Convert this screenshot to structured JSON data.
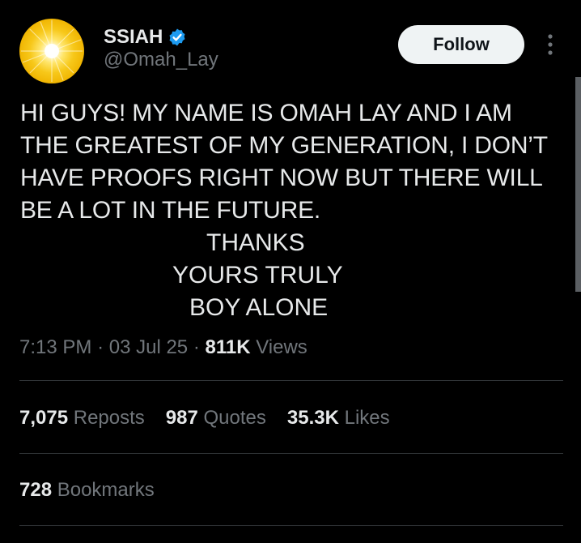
{
  "author": {
    "display_name": "SSIAH",
    "handle": "@Omah_Lay",
    "verified": true,
    "avatar_icon": "sun-avatar",
    "verified_icon": "verified-badge-icon",
    "verified_color": "#1d9bf0"
  },
  "actions": {
    "follow_label": "Follow",
    "more_icon": "more-vertical-icon"
  },
  "tweet": {
    "lines": [
      "HI GUYS! MY NAME IS OMAH LAY AND I AM",
      "THE GREATEST OF MY GENERATION, I DON’T",
      "HAVE PROOFS RIGHT NOW BUT THERE WILL",
      "BE A LOT IN THE FUTURE."
    ],
    "signoff": [
      "THANKS",
      "YOURS TRULY",
      "BOY ALONE"
    ]
  },
  "meta": {
    "time": "7:13 PM",
    "separator": "·",
    "date": "03 Jul 25",
    "views_count": "811K",
    "views_label": "Views"
  },
  "stats": {
    "reposts_count": "7,075",
    "reposts_label": "Reposts",
    "quotes_count": "987",
    "quotes_label": "Quotes",
    "likes_count": "35.3K",
    "likes_label": "Likes",
    "bookmarks_count": "728",
    "bookmarks_label": "Bookmarks"
  },
  "colors": {
    "background": "#000000",
    "text_primary": "#e7e9ea",
    "text_secondary": "#71767b",
    "divider": "#2f3336",
    "follow_bg": "#eff3f4"
  }
}
